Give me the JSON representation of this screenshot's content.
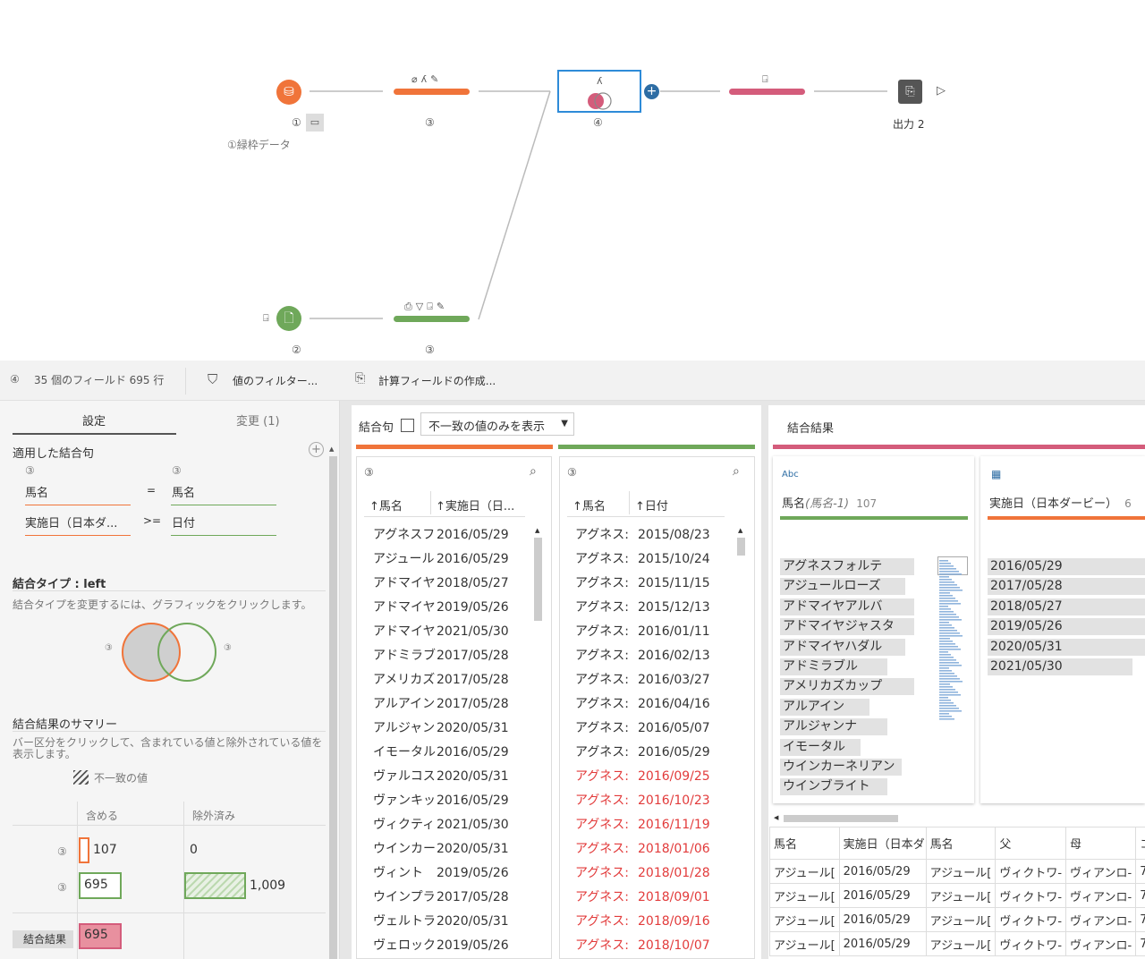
{
  "flow": {
    "input1": {
      "num": "①",
      "label": "①緑枠データ"
    },
    "clean1": {
      "num": "③"
    },
    "join": {
      "num": "④"
    },
    "input2": {
      "num": "②"
    },
    "clean2": {
      "num": "③"
    },
    "output": {
      "label": "出力 2"
    },
    "colors": {
      "orange": "#f0743a",
      "green": "#6fa85a",
      "pink": "#d45c7b",
      "blue": "#2e6da4"
    }
  },
  "toolbar": {
    "step_num": "④",
    "summary": "35 個のフィールド 695 行",
    "filter_label": "値のフィルター...",
    "calc_label": "計算フィールドの作成..."
  },
  "left_panel": {
    "tabs": [
      "設定",
      "変更 (1)"
    ],
    "applied_title": "適用した結合句",
    "left_src": "③",
    "right_src": "③",
    "clauses": [
      {
        "left": "馬名",
        "op": "=",
        "right": "馬名"
      },
      {
        "left": "実施日（日本ダ...",
        "op": ">=",
        "right": "日付"
      }
    ],
    "join_type_title": "結合タイプ : left",
    "join_type_hint": "結合タイプを変更するには、グラフィックをクリックします。",
    "venn_left": "③",
    "venn_right": "③",
    "summary_title": "結合結果のサマリー",
    "summary_hint": "バー区分をクリックして、含まれている値と除外されている値を表示します。",
    "mismatch_legend": "不一致の値",
    "col_include": "含める",
    "col_exclude": "除外済み",
    "rows": [
      {
        "src": "③",
        "include": "107",
        "exclude": "0"
      },
      {
        "src": "③",
        "include": "695",
        "exclude": "1,009"
      }
    ],
    "result_label": "結合結果",
    "result_value": "695"
  },
  "middle": {
    "clause_label": "結合句",
    "dropdown": "不一致の値のみを表示",
    "left_table": {
      "src": "③",
      "headers": [
        "馬名",
        "実施日（日..."
      ],
      "rows": [
        [
          "アグネスフ",
          "2016/05/29"
        ],
        [
          "アジュール",
          "2016/05/29"
        ],
        [
          "アドマイヤ",
          "2018/05/27"
        ],
        [
          "アドマイヤ",
          "2019/05/26"
        ],
        [
          "アドマイヤ",
          "2021/05/30"
        ],
        [
          "アドミラブ",
          "2017/05/28"
        ],
        [
          "アメリカズ",
          "2017/05/28"
        ],
        [
          "アルアイン",
          "2017/05/28"
        ],
        [
          "アルジャン",
          "2020/05/31"
        ],
        [
          "イモータル",
          "2016/05/29"
        ],
        [
          "ヴァルコス",
          "2020/05/31"
        ],
        [
          "ヴァンキッ",
          "2016/05/29"
        ],
        [
          "ヴィクティ",
          "2021/05/30"
        ],
        [
          "ウインカー",
          "2020/05/31"
        ],
        [
          "ヴィント",
          "2019/05/26"
        ],
        [
          "ウインプラ",
          "2017/05/28"
        ],
        [
          "ヴェルトラ",
          "2020/05/31"
        ],
        [
          "ヴェロック",
          "2019/05/26"
        ]
      ]
    },
    "right_table": {
      "src": "③",
      "headers": [
        "馬名",
        "日付"
      ],
      "rows": [
        [
          "アグネス:",
          "2015/08/23",
          false
        ],
        [
          "アグネス:",
          "2015/10/24",
          false
        ],
        [
          "アグネス:",
          "2015/11/15",
          false
        ],
        [
          "アグネス:",
          "2015/12/13",
          false
        ],
        [
          "アグネス:",
          "2016/01/11",
          false
        ],
        [
          "アグネス:",
          "2016/02/13",
          false
        ],
        [
          "アグネス:",
          "2016/03/27",
          false
        ],
        [
          "アグネス:",
          "2016/04/16",
          false
        ],
        [
          "アグネス:",
          "2016/05/07",
          false
        ],
        [
          "アグネス:",
          "2016/05/29",
          false
        ],
        [
          "アグネス:",
          "2016/09/25",
          true
        ],
        [
          "アグネス:",
          "2016/10/23",
          true
        ],
        [
          "アグネス:",
          "2016/11/19",
          true
        ],
        [
          "アグネス:",
          "2018/01/06",
          true
        ],
        [
          "アグネス:",
          "2018/01/28",
          true
        ],
        [
          "アグネス:",
          "2018/09/01",
          true
        ],
        [
          "アグネス:",
          "2018/09/16",
          true
        ],
        [
          "アグネス:",
          "2018/10/07",
          true
        ]
      ]
    }
  },
  "result": {
    "title": "結合結果",
    "profile1": {
      "type": "Abc",
      "name": "馬名",
      "alias": "(馬名-1)",
      "count": "107",
      "values": [
        "アグネスフォルテ",
        "アジュールローズ",
        "アドマイヤアルバ",
        "アドマイヤジャスタ",
        "アドマイヤハダル",
        "アドミラブル",
        "アメリカズカップ",
        "アルアイン",
        "アルジャンナ",
        "イモータル",
        "ウインカーネリアン",
        "ウインブライト"
      ]
    },
    "profile2": {
      "name": "実施日（日本ダービー）",
      "count": "6",
      "values": [
        "2016/05/29",
        "2017/05/28",
        "2018/05/27",
        "2019/05/26",
        "2020/05/31",
        "2021/05/30"
      ]
    },
    "grid_headers": [
      "馬名",
      "実施日（日本ダ",
      "馬名",
      "父",
      "母",
      "コ"
    ],
    "grid_rows": [
      [
        "アジュール[",
        "2016/05/29",
        "アジュール[",
        "ヴィクトワ-",
        "ヴィアンロ-",
        "7("
      ],
      [
        "アジュール[",
        "2016/05/29",
        "アジュール[",
        "ヴィクトワ-",
        "ヴィアンロ-",
        "7("
      ],
      [
        "アジュール[",
        "2016/05/29",
        "アジュール[",
        "ヴィクトワ-",
        "ヴィアンロ-",
        "7("
      ],
      [
        "アジュール[",
        "2016/05/29",
        "アジュール[",
        "ヴィクトワ-",
        "ヴィアンロ-",
        "7("
      ]
    ]
  }
}
